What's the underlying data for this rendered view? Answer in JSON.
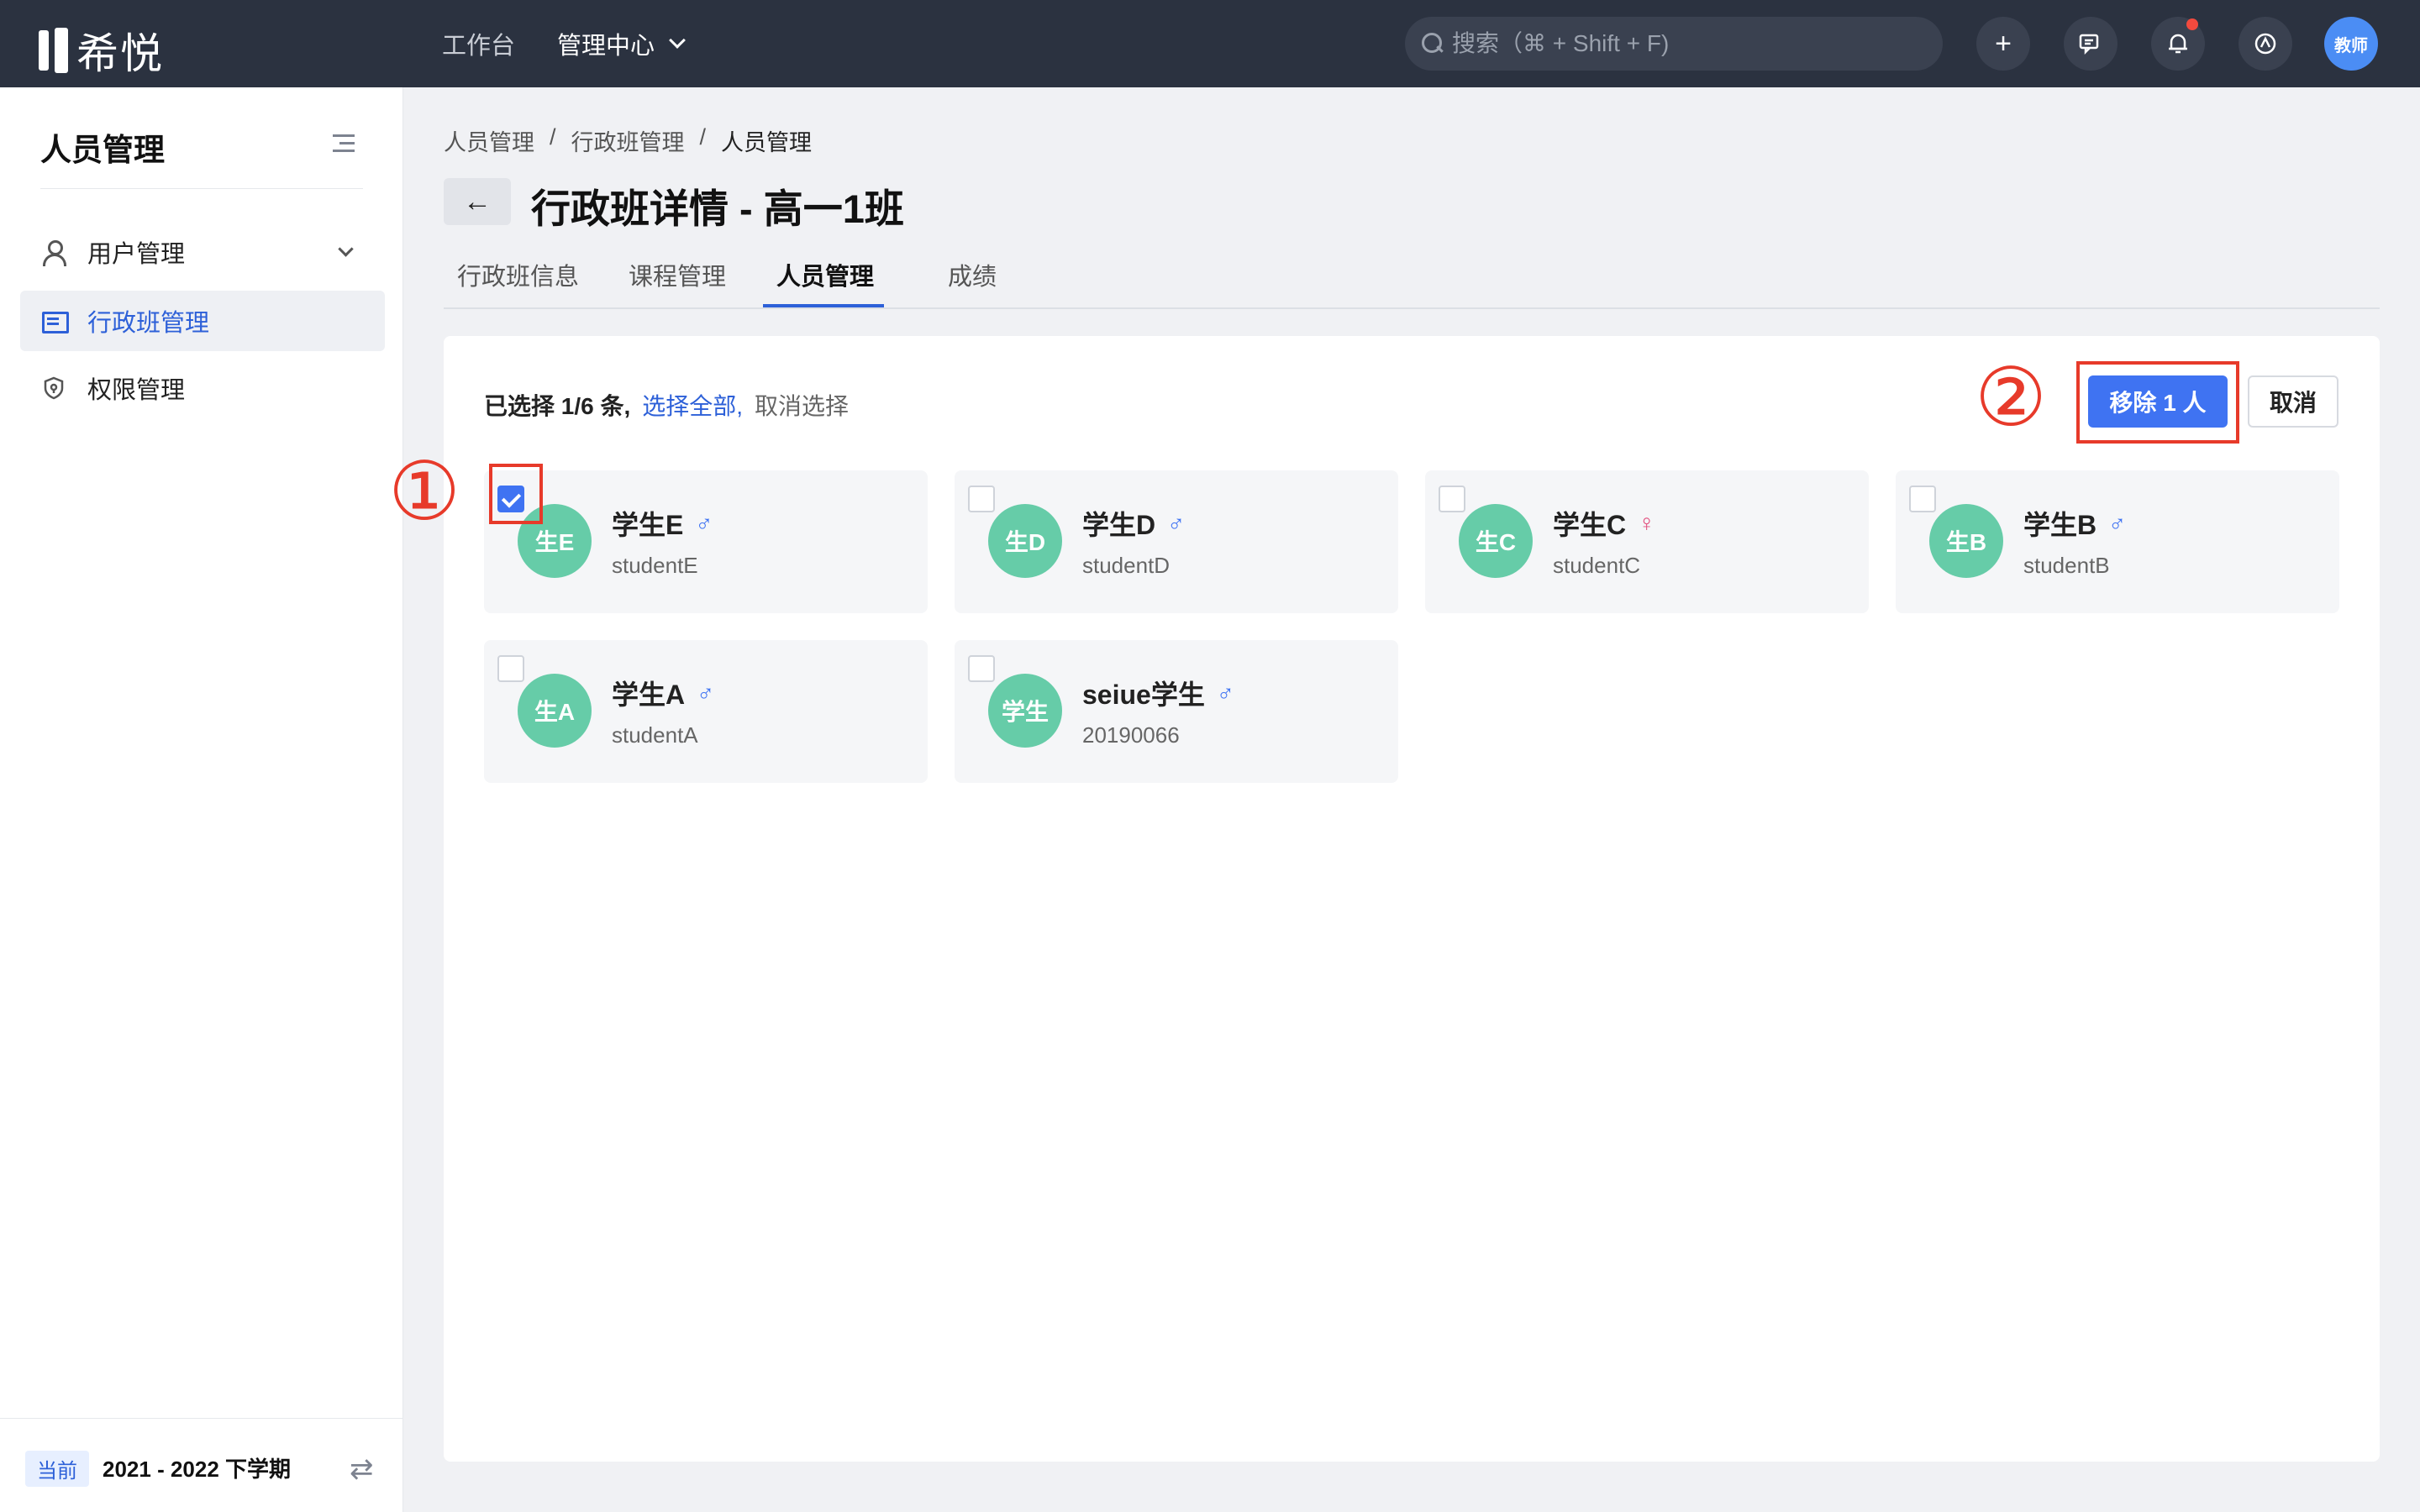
{
  "topbar": {
    "logo_text": "希悦",
    "nav": [
      {
        "label": "工作台"
      },
      {
        "label": "管理中心"
      }
    ],
    "search_placeholder": "搜索（⌘ + Shift + F)",
    "avatar_text": "教师",
    "icons": [
      "plus-icon",
      "chat-icon",
      "bell-icon",
      "settings-icon"
    ],
    "notification_dot_color": "#f24a3e"
  },
  "sidebar": {
    "title": "人员管理",
    "items": [
      {
        "label": "用户管理",
        "icon": "user-icon"
      },
      {
        "label": "行政班管理",
        "icon": "class-icon",
        "active": true
      },
      {
        "label": "权限管理",
        "icon": "shield-icon"
      }
    ],
    "footer": {
      "tag": "当前",
      "term": "2021 - 2022 下学期"
    }
  },
  "main": {
    "breadcrumb": [
      "人员管理",
      "行政班管理",
      "人员管理"
    ],
    "breadcrumb_sep": "/",
    "title": "行政班详情 - 高一1班",
    "tabs": [
      {
        "label": "行政班信息"
      },
      {
        "label": "课程管理"
      },
      {
        "label": "人员管理",
        "active": true
      },
      {
        "label": "成绩"
      }
    ],
    "selection": {
      "count_text": "已选择 1/6 条,",
      "select_all": "选择全部,",
      "cancel_select": "取消选择"
    },
    "remove_button": "移除 1 人",
    "cancel_button": "取消",
    "annotations": [
      "①",
      "②"
    ],
    "students": [
      {
        "avatar": "生E",
        "name": "学生E",
        "gender": "♂",
        "gender_type": "male",
        "id": "studentE",
        "checked": true
      },
      {
        "avatar": "生D",
        "name": "学生D",
        "gender": "♂",
        "gender_type": "male",
        "id": "studentD",
        "checked": false
      },
      {
        "avatar": "生C",
        "name": "学生C",
        "gender": "♀",
        "gender_type": "female",
        "id": "studentC",
        "checked": false
      },
      {
        "avatar": "生B",
        "name": "学生B",
        "gender": "♂",
        "gender_type": "male",
        "id": "studentB",
        "checked": false
      },
      {
        "avatar": "生A",
        "name": "学生A",
        "gender": "♂",
        "gender_type": "male",
        "id": "studentA",
        "checked": false
      },
      {
        "avatar": "学生",
        "name": "seiue学生",
        "gender": "♂",
        "gender_type": "male",
        "id": "20190066",
        "checked": false
      }
    ]
  },
  "colors": {
    "accent": "#3f73f2",
    "avatar_green": "#66cca8",
    "annotation_red": "#e73a2a",
    "topbar_bg": "#2b3240"
  }
}
